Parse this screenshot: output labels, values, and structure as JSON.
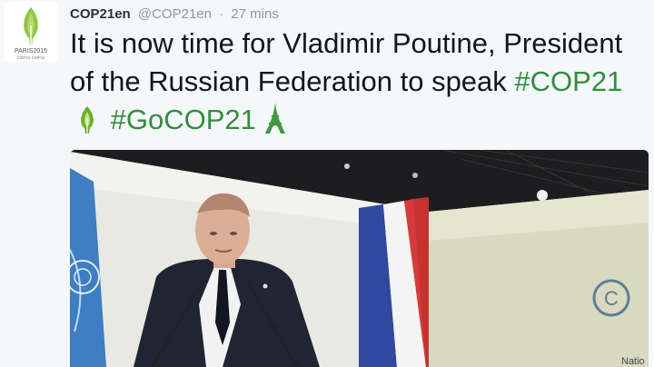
{
  "tweet": {
    "display_name": "COP21en",
    "handle": "@COP21en",
    "separator": "·",
    "time": "27 mins",
    "avatar": {
      "logo_line1": "PARIS2015",
      "logo_line2": "COP21·CMP11",
      "icon": "leaf-icon",
      "leaf_color": "#8dc63f"
    },
    "text_plain": "It is now time for Vladimir Poutine, President of the Russian Federation to speak",
    "hashtags": [
      "#COP21",
      "#GoCOP21"
    ],
    "emojis": [
      "cop21-leaf-icon",
      "eiffel-tower-icon"
    ],
    "accent_color": "#2f8f3a"
  },
  "media": {
    "description_icon": "photo-image",
    "screen_text": "Natio"
  }
}
